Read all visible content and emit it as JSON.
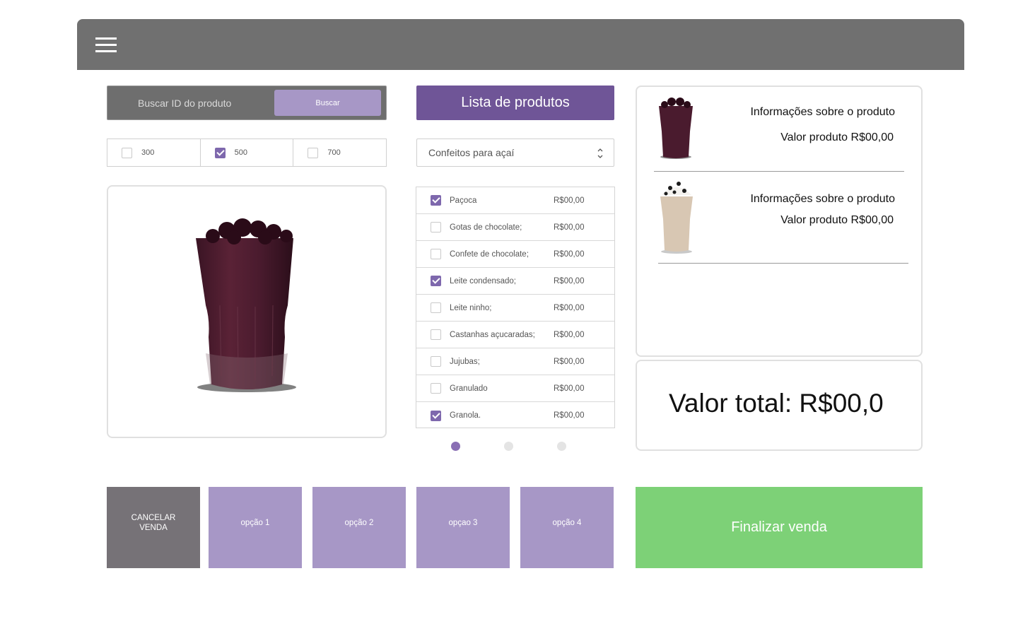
{
  "header": {
    "menu_icon": "hamburger-menu-icon",
    "color": "#707070"
  },
  "search": {
    "placeholder": "Buscar ID do produto",
    "value": "",
    "button_label": "Buscar"
  },
  "sizes": [
    {
      "label": "300",
      "checked": false
    },
    {
      "label": "500",
      "checked": true
    },
    {
      "label": "700",
      "checked": false
    }
  ],
  "product_image": {
    "icon": "acai-cup-image"
  },
  "product_list": {
    "title": "Lista de produtos",
    "category": "Confeitos para açaí",
    "items": [
      {
        "name": "Paçoca",
        "price": "R$00,00",
        "checked": true
      },
      {
        "name": "Gotas de chocolate;",
        "price": "R$00,00",
        "checked": false
      },
      {
        "name": "Confete de chocolate;",
        "price": "R$00,00",
        "checked": false
      },
      {
        "name": "Leite condensado;",
        "price": "R$00,00",
        "checked": true
      },
      {
        "name": "Leite ninho;",
        "price": "R$00,00",
        "checked": false
      },
      {
        "name": "Castanhas açucaradas;",
        "price": "R$00,00",
        "checked": false
      },
      {
        "name": "Jujubas;",
        "price": "R$00,00",
        "checked": false
      },
      {
        "name": "Granulado",
        "price": "R$00,00",
        "checked": false
      },
      {
        "name": "Granola.",
        "price": "R$00,00",
        "checked": true
      }
    ],
    "pagination": {
      "current_page": 1,
      "total_pages": 3
    }
  },
  "cart": {
    "items": [
      {
        "info": "Informações sobre o produto",
        "value": "Valor produto R$00,00",
        "image": "acai-cup-thumbnail"
      },
      {
        "info": "Informações sobre o produto",
        "value": "Valor produto R$00,00",
        "image": "milkshake-cup-thumbnail"
      }
    ],
    "total": "Valor total: R$00,0"
  },
  "actions": {
    "cancel": "CANCELAR VENDA",
    "option1": "opção 1",
    "option2": "opção 2",
    "option3": "opçao 3",
    "option4": "opção 4",
    "finalize": "Finalizar venda"
  },
  "colors": {
    "accent": "#6f5597",
    "option_button": "#a797c6",
    "cancel": "#767277",
    "finalize": "#7dd177",
    "checkbox_checked": "#7e68ad"
  }
}
